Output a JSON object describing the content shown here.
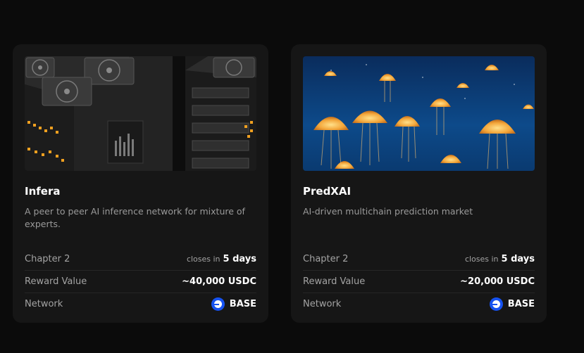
{
  "cards": [
    {
      "title": "Infera",
      "description": "A peer to peer AI inference network for mixture of experts.",
      "chapter": "Chapter 2",
      "closes_prefix": "closes in",
      "closes_value": "5 days",
      "reward_label": "Reward Value",
      "reward_value": "~40,000 USDC",
      "network_label": "Network",
      "network_value": "BASE",
      "image": "server-racks-image"
    },
    {
      "title": "PredXAI",
      "description": "AI-driven multichain prediction market",
      "chapter": "Chapter 2",
      "closes_prefix": "closes in",
      "closes_value": "5 days",
      "reward_label": "Reward Value",
      "reward_value": "~20,000 USDC",
      "network_label": "Network",
      "network_value": "BASE",
      "image": "jellyfish-image"
    }
  ],
  "colors": {
    "background": "#0b0b0b",
    "card": "#161616",
    "base_blue": "#1652f0"
  }
}
